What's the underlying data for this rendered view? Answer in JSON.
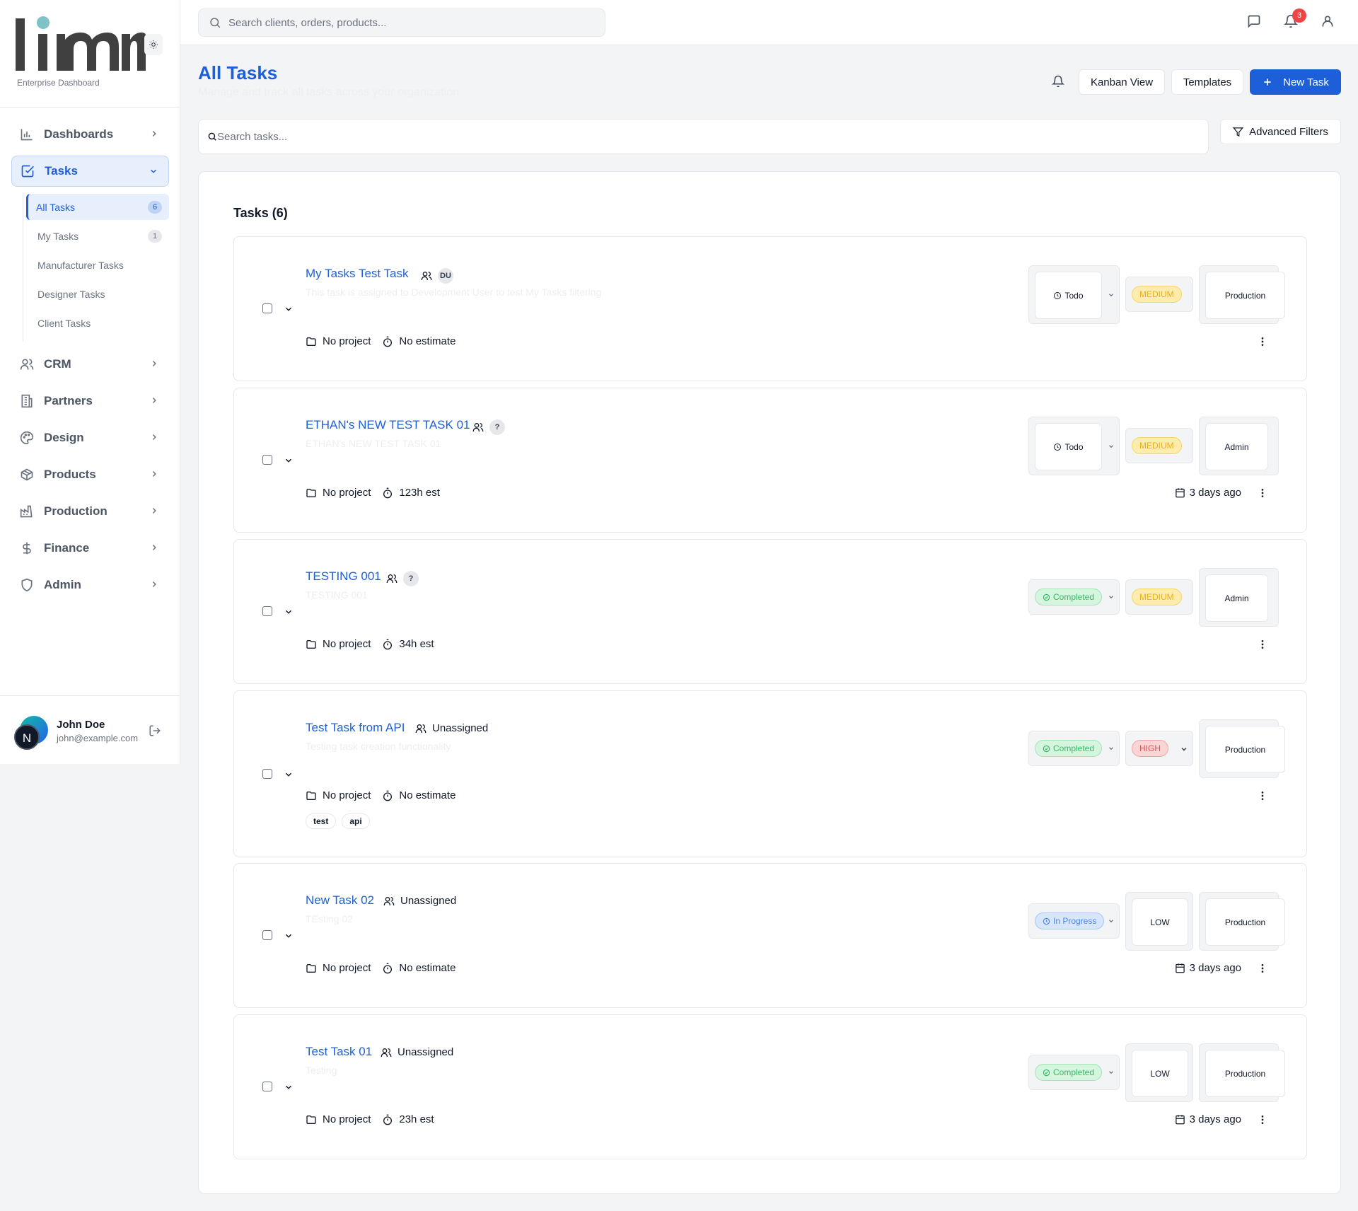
{
  "app": {
    "logo_text": "limn",
    "subtitle": "Enterprise Dashboard"
  },
  "topbar": {
    "search_placeholder": "Search clients, orders, products...",
    "notification_count": "3"
  },
  "sidebar": {
    "items": [
      {
        "label": "Dashboards",
        "icon": "bar-chart-icon"
      },
      {
        "label": "Tasks",
        "icon": "check-square-icon"
      },
      {
        "label": "CRM",
        "icon": "users-icon"
      },
      {
        "label": "Partners",
        "icon": "building-icon"
      },
      {
        "label": "Design",
        "icon": "palette-icon"
      },
      {
        "label": "Products",
        "icon": "box-icon"
      },
      {
        "label": "Production",
        "icon": "factory-icon"
      },
      {
        "label": "Finance",
        "icon": "dollar-icon"
      },
      {
        "label": "Admin",
        "icon": "shield-icon"
      }
    ],
    "tasks_sub": [
      {
        "label": "All Tasks",
        "badge": "6"
      },
      {
        "label": "My Tasks",
        "badge": "1"
      },
      {
        "label": "Manufacturer Tasks",
        "badge": ""
      },
      {
        "label": "Designer Tasks",
        "badge": ""
      },
      {
        "label": "Client Tasks",
        "badge": ""
      }
    ]
  },
  "user": {
    "initial": "N",
    "name": "John Doe",
    "email": "john@example.com"
  },
  "page": {
    "title": "All Tasks",
    "subtitle": "Manage and track all tasks across your organization",
    "kanban_label": "Kanban View",
    "templates_label": "Templates",
    "new_task_label": "New Task",
    "search_placeholder": "Search tasks...",
    "filters_label": "Advanced Filters",
    "list_title": "Tasks (6)"
  },
  "tasks": [
    {
      "title": "My Tasks Test Task",
      "assignee": "",
      "assignee_chip": "DU",
      "description": "This task is assigned to Development User to test My Tasks filtering",
      "project": "No project",
      "estimate": "No estimate",
      "status": "Todo",
      "priority": "MEDIUM",
      "department": "Production",
      "date": "",
      "tags": []
    },
    {
      "title": "ETHAN's NEW TEST TASK 01",
      "assignee": "",
      "assignee_chip": "?",
      "description": "ETHAN's NEW TEST TASK 01",
      "project": "No project",
      "estimate": "123h est",
      "status": "Todo",
      "priority": "MEDIUM",
      "department": "Admin",
      "date": "3 days ago",
      "tags": []
    },
    {
      "title": "TESTING 001",
      "assignee": "",
      "assignee_chip": "?",
      "description": "TESTING 001",
      "project": "No project",
      "estimate": "34h est",
      "status": "Completed",
      "priority": "MEDIUM",
      "department": "Admin",
      "date": "",
      "tags": []
    },
    {
      "title": "Test Task from API",
      "assignee": "Unassigned",
      "assignee_chip": "",
      "description": "Testing task creation functionality",
      "project": "No project",
      "estimate": "No estimate",
      "status": "Completed",
      "priority": "HIGH",
      "department": "Production",
      "date": "",
      "tags": [
        "test",
        "api"
      ]
    },
    {
      "title": "New Task 02",
      "assignee": "Unassigned",
      "assignee_chip": "",
      "description": "TEsting 02",
      "project": "No project",
      "estimate": "No estimate",
      "status": "In Progress",
      "priority": "LOW",
      "department": "Production",
      "date": "3 days ago",
      "tags": []
    },
    {
      "title": "Test Task 01",
      "assignee": "Unassigned",
      "assignee_chip": "",
      "description": "Testing",
      "project": "No project",
      "estimate": "23h est",
      "status": "Completed",
      "priority": "LOW",
      "department": "Production",
      "date": "3 days ago",
      "tags": []
    }
  ],
  "colors": {
    "accent": "#1d5fd9",
    "medium": "#e8b21a",
    "high": "#e05252",
    "completed": "#36b865",
    "in_progress": "#4a88e8"
  }
}
